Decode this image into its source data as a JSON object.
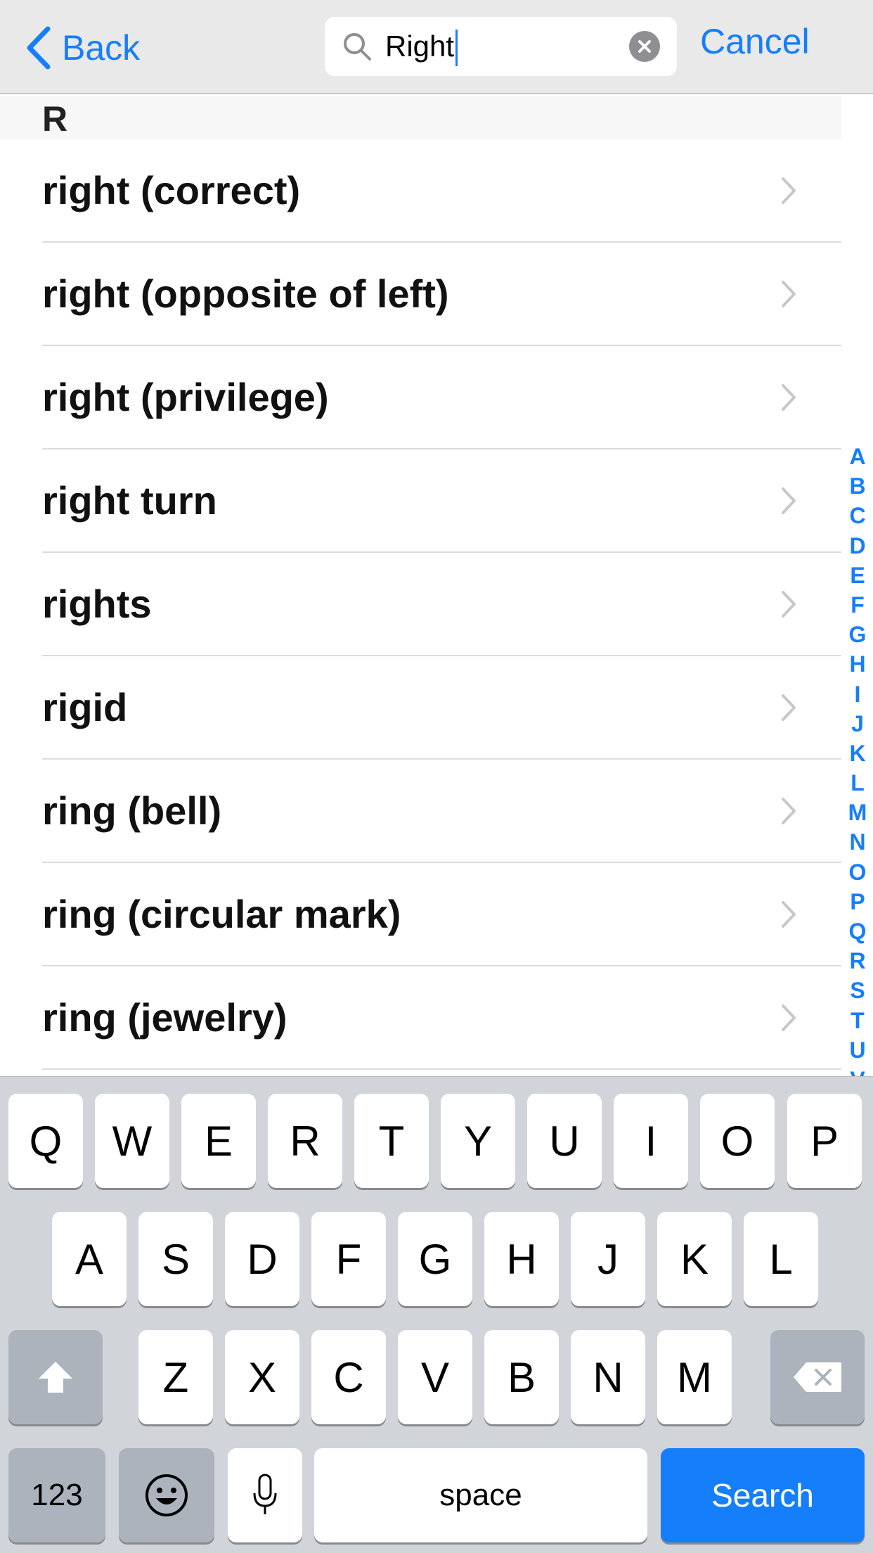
{
  "navbar": {
    "back_label": "Back",
    "search_value": "Right",
    "cancel_label": "Cancel"
  },
  "section": {
    "header": "R"
  },
  "results": [
    {
      "label": "right (correct)"
    },
    {
      "label": "right (opposite of left)"
    },
    {
      "label": "right (privilege)"
    },
    {
      "label": "right turn"
    },
    {
      "label": "rights"
    },
    {
      "label": "rigid"
    },
    {
      "label": "ring (bell)"
    },
    {
      "label": "ring (circular mark)"
    },
    {
      "label": "ring (jewelry)"
    }
  ],
  "index_letters": [
    "A",
    "B",
    "C",
    "D",
    "E",
    "F",
    "G",
    "H",
    "I",
    "J",
    "K",
    "L",
    "M",
    "N",
    "O",
    "P",
    "Q",
    "R",
    "S",
    "T",
    "U",
    "V"
  ],
  "keyboard": {
    "row1": [
      "Q",
      "W",
      "E",
      "R",
      "T",
      "Y",
      "U",
      "I",
      "O",
      "P"
    ],
    "row2": [
      "A",
      "S",
      "D",
      "F",
      "G",
      "H",
      "J",
      "K",
      "L"
    ],
    "row3": [
      "Z",
      "X",
      "C",
      "V",
      "B",
      "N",
      "M"
    ],
    "numbers_label": "123",
    "space_label": "space",
    "search_label": "Search"
  },
  "colors": {
    "accent": "#157efb",
    "search_key": "#147efb"
  }
}
